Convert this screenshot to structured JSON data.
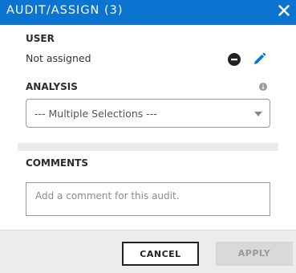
{
  "dialog": {
    "title": "AUDIT/ASSIGN (3)"
  },
  "user": {
    "label": "USER",
    "value": "Not assigned"
  },
  "analysis": {
    "label": "ANALYSIS",
    "selected": "--- Multiple Selections ---"
  },
  "comments": {
    "label": "COMMENTS",
    "placeholder": "Add a comment for this audit."
  },
  "footer": {
    "cancel_label": "CANCEL",
    "apply_label": "APPLY"
  },
  "colors": {
    "header": "#0b74d1",
    "edit_icon": "#0b74d1",
    "remove_icon": "#222222"
  },
  "icons": {
    "close": "close-icon",
    "remove": "remove-circle-icon",
    "edit": "pencil-icon",
    "info": "info-icon",
    "dropdown": "chevron-down-icon"
  }
}
